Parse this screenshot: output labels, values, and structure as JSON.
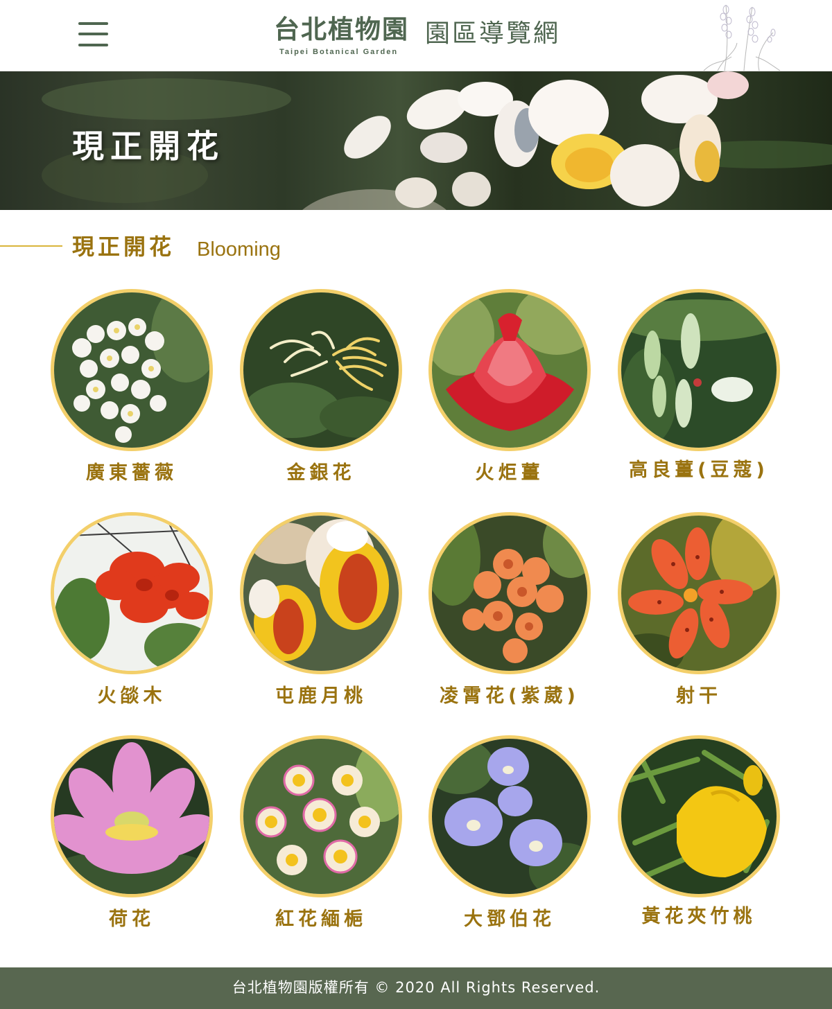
{
  "header": {
    "logo_cn": "台北植物園",
    "logo_en": "Taipei  Botanical  Garden",
    "site_title": "園區導覽網",
    "menu_icon": "hamburger-menu-icon",
    "decoration_icon": "lavender-sketch-icon"
  },
  "banner": {
    "title": "現正開花"
  },
  "section": {
    "title": "現正開花",
    "subtitle": "Blooming"
  },
  "flowers": [
    {
      "name": "廣東薔薇",
      "color": "#f4f1ea"
    },
    {
      "name": "金銀花",
      "color": "#efe3a6"
    },
    {
      "name": "火炬薑",
      "color": "#d8212e"
    },
    {
      "name": "高良薑(豆蔻)",
      "color": "#cfe3bd"
    },
    {
      "name": "火燄木",
      "color": "#e03a1c"
    },
    {
      "name": "屯鹿月桃",
      "color": "#f2c41e"
    },
    {
      "name": "凌霄花(紫葳)",
      "color": "#f08a4f"
    },
    {
      "name": "射干",
      "color": "#ec5e33"
    },
    {
      "name": "荷花",
      "color": "#e292cf"
    },
    {
      "name": "紅花緬梔",
      "color": "#f6ebd6"
    },
    {
      "name": "大鄧伯花",
      "color": "#a7a6ec"
    },
    {
      "name": "黃花夾竹桃",
      "color": "#f3c713"
    }
  ],
  "colors": {
    "brand_green": "#4f6650",
    "gold_text": "#9a7310",
    "circle_border": "#f3cf6a",
    "footer_bg": "#586750"
  },
  "footer": {
    "copyright": "台北植物園版權所有 © 2020 All Rights Reserved."
  }
}
